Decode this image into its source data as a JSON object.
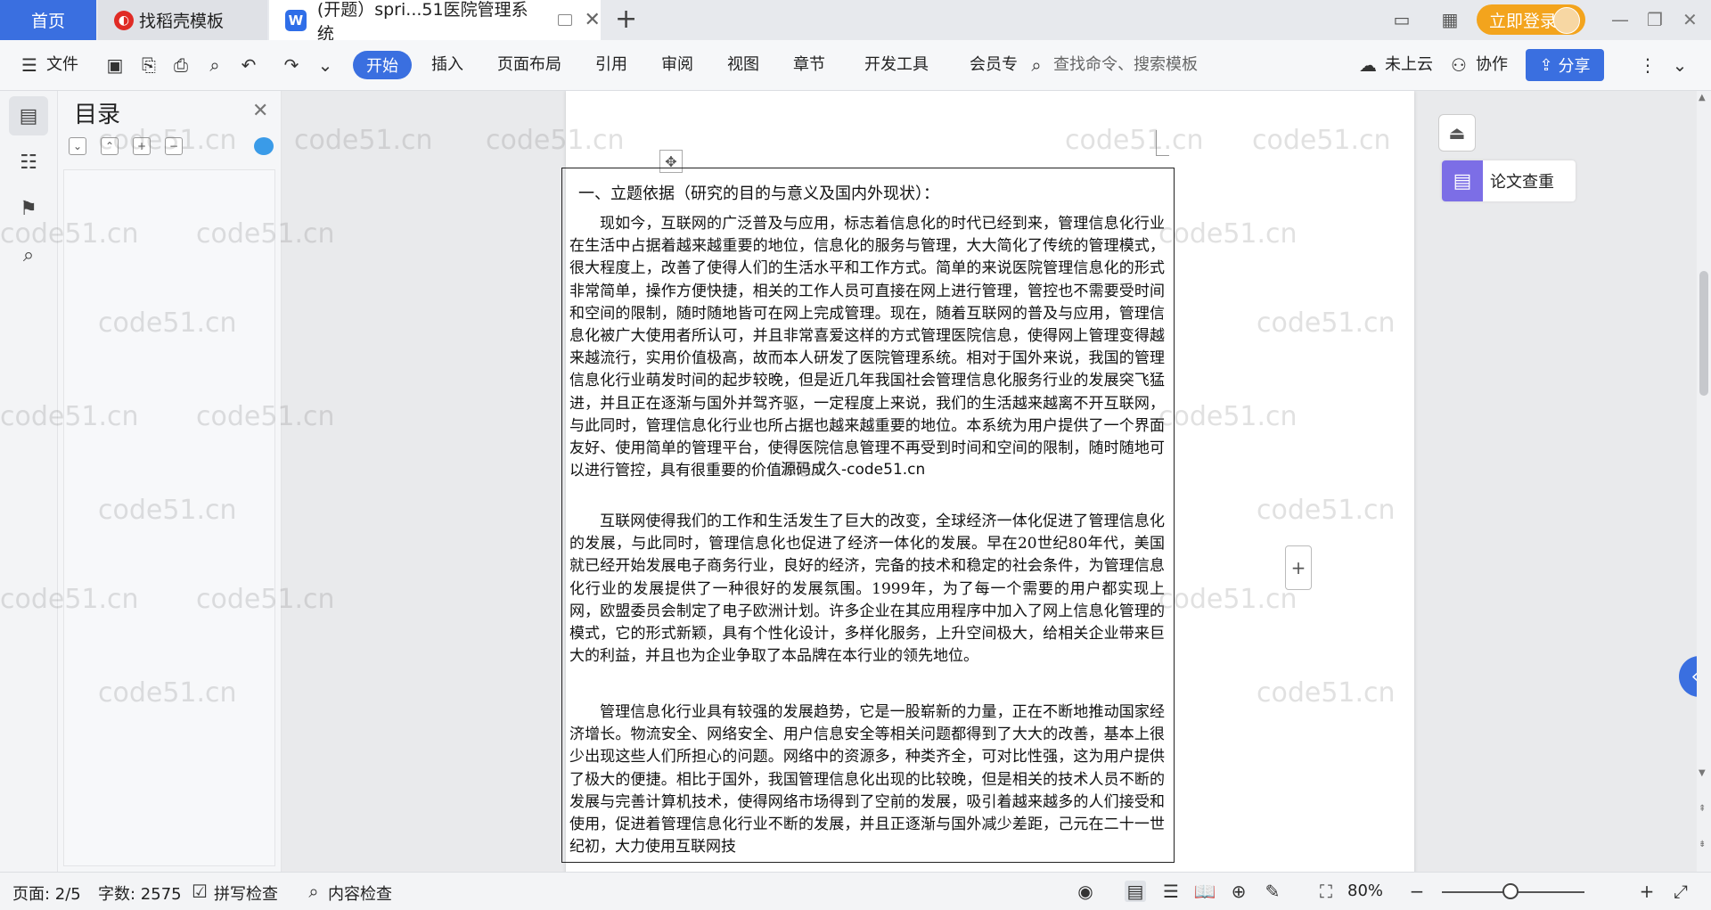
{
  "tabs": {
    "home": "首页",
    "template": "找稻壳模板",
    "document": "(开题）spri...51医院管理系统",
    "new_tab": "+"
  },
  "account": {
    "login": "立即登录"
  },
  "toolbar": {
    "file": "文件",
    "menus": [
      "开始",
      "插入",
      "页面布局",
      "引用",
      "审阅",
      "视图",
      "章节",
      "开发工具",
      "会员专"
    ],
    "search": "查找命令、搜索模板",
    "cloud": "未上云",
    "collab": "协作",
    "share": "分享"
  },
  "toc": {
    "title": "目录"
  },
  "document": {
    "heading": "一、立题依据（研究的目的与意义及国内外现状）：",
    "paragraphs": [
      "现如今，互联网的广泛普及与应用，标志着信息化的时代已经到来，管理信息化行业在生活中占据着越来越重要的地位，信息化的服务与管理，大大简化了传统的管理模式，很大程度上，改善了使得人们的生活水平和工作方式。简单的来说医院管理信息化的形式非常简单，操作方便快捷，相关的工作人员可直接在网上进行管理，管控也不需要受时间和空间的限制，随时随地皆可在网上完成管理。现在，随着互联网的普及与应用，管理信息化被广大使用者所认可，并且非常喜爱这样的方式管理医院信息，使得网上管理变得越来越流行，实用价值极高，故而本人研发了医院管理系统。相对于国外来说，我国的管理信息化行业萌发时间的起步较晚，但是近几年我国社会管理信息化服务行业的发展突飞猛进，并且正在逐渐与国外并驾齐驱，一定程度上来说，我们的生活越来越离不开互联网，与此同时，管理信息化行业也所占据也越来越重要的地位。本系统为用户提供了一个界面友好、使用简单的管理平台，使得医院信息管理不再受到时间和空间的限制，随时随地可以进行管控，具有很重要的价值和意义",
      "互联网使得我们的工作和生活发生了巨大的改变，全球经济一体化促进了管理信息化的发展，与此同时，管理信息化也促进了经济一体化的发展。早在20世纪80年代，美国就已经开始发展电子商务行业，良好的经济，完备的技术和稳定的社会条件，为管理信息化行业的发展提供了一种很好的发展氛围。1999年，为了每一个需要的用户都实现上网，欧盟委员会制定了电子欧洲计划。许多企业在其应用程序中加入了网上信息化管理的模式，它的形式新颖，具有个性化设计，多样化服务，上升空间极大，给相关企业带来巨大的利益，并且也为企业争取了本品牌在本行业的领先地位。",
      "管理信息化行业具有较强的发展趋势，它是一股崭新的力量，正在不断地推动国家经济增长。物流安全、网络安全、用户信息安全等相关问题都得到了大大的改善，基本上很少出现这些人们所担心的问题。网络中的资源多，种类齐全，可对比性强，这为用户提供了极大的便捷。相比于国外，我国管理信息化出现的比较晚，但是相关的技术人员不断的发展与完善计算机技术，使得网络市场得到了空前的发展，吸引着越来越多的人们接受和使用，促进着管理信息化行业不断的发展，并且正逐渐与国外减少差距，己元在二十一世纪初，大力使用互联网技"
    ],
    "overlay": "源码成久-code51.cn"
  },
  "right_panel": {
    "plagiarism": "论文查重"
  },
  "watermark": "code51.cn",
  "status": {
    "page": "页面: 2/5",
    "words": "字数: 2575",
    "spell": "拼写检查",
    "content": "内容检查",
    "zoom": "80%"
  }
}
